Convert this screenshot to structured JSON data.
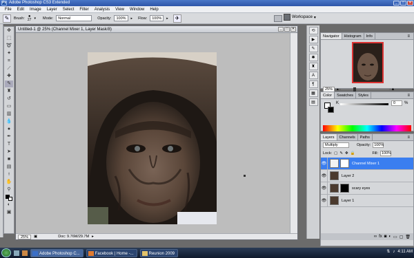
{
  "titlebar": {
    "title": "Adobe Photoshop CS3 Extended",
    "logo": "Ps"
  },
  "menu": [
    "File",
    "Edit",
    "Image",
    "Layer",
    "Select",
    "Filter",
    "Analysis",
    "View",
    "Window",
    "Help"
  ],
  "options": {
    "brush_label": "Brush:",
    "brush_size": "27",
    "mode_label": "Mode:",
    "mode_value": "Normal",
    "opacity_label": "Opacity:",
    "opacity_value": "100%",
    "flow_label": "Flow:",
    "flow_value": "100%",
    "workspace": "Workspace"
  },
  "document": {
    "title": "Untitled-1 @ 25% (Channel Mixer 1, Layer Mask/8)",
    "zoom": "25%",
    "doc_size": "Doc: 9.76M/29.7M"
  },
  "navigator": {
    "tabs": [
      "Navigator",
      "Histogram",
      "Info"
    ],
    "zoom": "25%"
  },
  "color": {
    "tabs": [
      "Color",
      "Swatches",
      "Styles"
    ],
    "channel": "K",
    "value": "0",
    "unit": "%"
  },
  "layers": {
    "tabs": [
      "Layers",
      "Channels",
      "Paths"
    ],
    "blend": "Multiply",
    "opacity_label": "Opacity:",
    "opacity": "100%",
    "lock_label": "Lock:",
    "fill_label": "Fill:",
    "fill": "100%",
    "items": [
      {
        "name": "Channel Mixer 1",
        "active": true,
        "mask": "white"
      },
      {
        "name": "Layer 2",
        "active": false,
        "mask": ""
      },
      {
        "name": "scary eyes",
        "active": false,
        "mask": "black"
      },
      {
        "name": "Layer 1",
        "active": false,
        "mask": ""
      }
    ]
  },
  "taskbar": {
    "tasks": [
      "Adobe Photoshop C...",
      "Facebook | Home -...",
      "Reunion 2009"
    ],
    "time": "4:11 AM"
  }
}
